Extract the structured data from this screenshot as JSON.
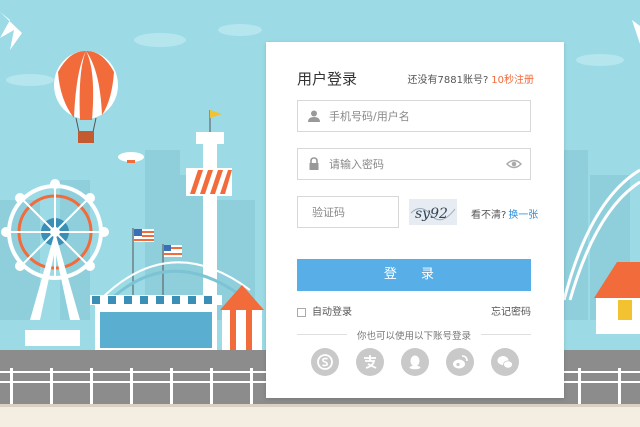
{
  "login": {
    "title": "用户登录",
    "register_prompt": "还没有7881账号?",
    "register_link": "10秒注册",
    "username_placeholder": "手机号码/用户名",
    "password_placeholder": "请输入密码",
    "captcha_placeholder": "验证码",
    "captcha_text": "sy92",
    "captcha_unclear": "看不清?",
    "captcha_refresh": "换一张",
    "login_button": "登 录",
    "auto_login": "自动登录",
    "forgot_password": "忘记密码",
    "alt_login_text": "你也可以使用以下账号登录",
    "social_icons": [
      "sogou-icon",
      "alipay-icon",
      "qq-icon",
      "weibo-icon",
      "wechat-icon"
    ]
  },
  "colors": {
    "sky": "#9cdbe6",
    "accent_orange": "#f26b3a",
    "button_blue": "#58aee6",
    "link_blue": "#2f8fdc"
  }
}
